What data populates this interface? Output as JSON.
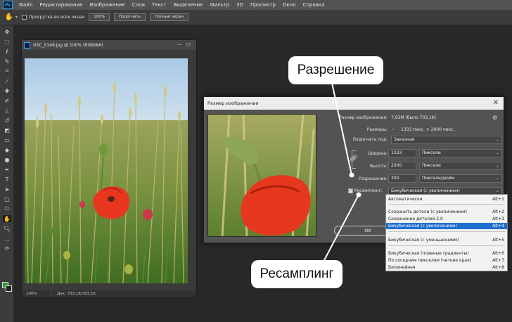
{
  "menubar": {
    "items": [
      "Файл",
      "Редактирование",
      "Изображение",
      "Слои",
      "Текст",
      "Выделение",
      "Фильтр",
      "3D",
      "Просмотр",
      "Окно",
      "Справка"
    ]
  },
  "options": {
    "scroll_all_label": "Прокрутка во всех окнах",
    "zoom_100": "100%",
    "fit_label": "Подогнать",
    "full_label": "Полный экран"
  },
  "document": {
    "title": "DSC_0146.jpg @ 100% (RGB/8#)",
    "zoom": "100%",
    "doc_info": "Док: 703,1K/703,1K"
  },
  "dialog": {
    "title": "Размер изображения",
    "image_size_label": "Размер изображения:",
    "image_size_value": "7,63М (было 703,1K)",
    "dimensions_label": "Размеры:",
    "dimensions_value": "1333 пикс. × 2000 пикс.",
    "fit_to_label": "Подогнать под:",
    "fit_to_value": "Заказная",
    "width_label": "Ширина:",
    "width_value": "1333",
    "width_unit": "Пиксели",
    "height_label": "Высота:",
    "height_value": "2000",
    "height_unit": "Пиксели",
    "resolution_label": "Разрешение:",
    "resolution_value": "300",
    "resolution_unit": "Пиксели/дюйм",
    "resample_label": "Ресамплинг:",
    "resample_value": "Бикубическая (с увеличением)",
    "ok_label": "OK"
  },
  "dropdown": {
    "options": [
      {
        "label": "Автоматически",
        "shortcut": "Alt+1"
      },
      {
        "label": "Сохранить детали (с увеличением)",
        "shortcut": "Alt+2"
      },
      {
        "label": "Сохранение деталей 2.0",
        "shortcut": "Alt+3"
      },
      {
        "label": "Бикубическая (с увеличением)",
        "shortcut": "Alt+4"
      },
      {
        "label": "Бикубическая (с уменьшением)",
        "shortcut": "Alt+5"
      },
      {
        "label": "Бикубическая (плавные градиенты)",
        "shortcut": "Alt+6"
      },
      {
        "label": "По соседним пикселям (четкие края)",
        "shortcut": "Alt+7"
      },
      {
        "label": "Билинейная",
        "shortcut": "Alt+8"
      }
    ],
    "selected_index": 3
  },
  "callouts": {
    "resolution": "Разрешение",
    "resampling": "Ресамплинг"
  },
  "colors": {
    "accent": "#1e6fd0",
    "foreground_swatch": "#1e9d3a",
    "callout_bg": "#ffffff"
  },
  "icons": [
    "hand-icon",
    "move-icon",
    "marquee-icon",
    "lasso-icon",
    "quick-select-icon",
    "crop-icon",
    "eyedropper-icon",
    "healing-icon",
    "brush-icon",
    "stamp-icon",
    "history-brush-icon",
    "eraser-icon",
    "gradient-icon",
    "blur-icon",
    "dodge-icon",
    "pen-icon",
    "type-icon",
    "path-select-icon",
    "rectangle-icon",
    "hand-tool-icon",
    "zoom-icon",
    "more-icon",
    "gear-icon",
    "chain-link-icon",
    "close-icon"
  ]
}
